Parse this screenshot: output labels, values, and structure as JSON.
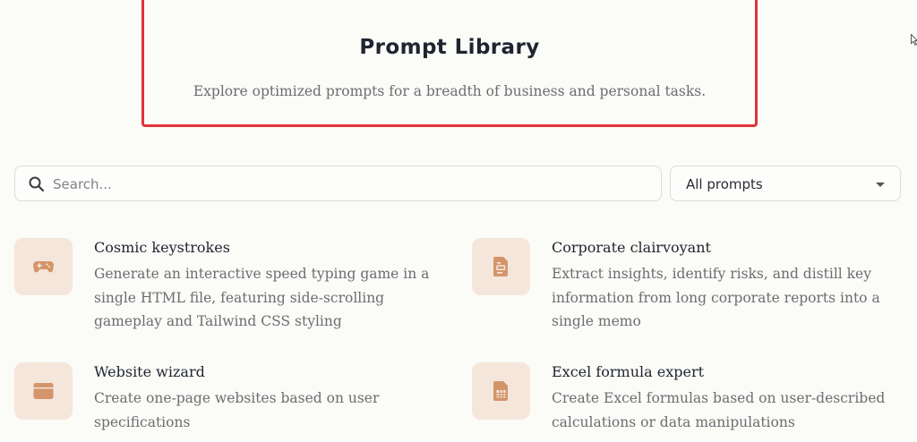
{
  "header": {
    "title": "Prompt Library",
    "subtitle": "Explore optimized prompts for a breadth of business and personal tasks."
  },
  "search": {
    "placeholder": "Search...",
    "value": ""
  },
  "filter": {
    "selected": "All prompts"
  },
  "cards": [
    {
      "icon": "gamepad-icon",
      "title": "Cosmic keystrokes",
      "description": "Generate an interactive speed typing game in a single HTML file, featuring side-scrolling gameplay and Tailwind CSS styling"
    },
    {
      "icon": "document-icon",
      "title": "Corporate clairvoyant",
      "description": "Extract insights, identify risks, and distill key information from long corporate reports into a single memo"
    },
    {
      "icon": "browser-window-icon",
      "title": "Website wizard",
      "description": "Create one-page websites based on user specifications"
    },
    {
      "icon": "spreadsheet-icon",
      "title": "Excel formula expert",
      "description": "Create Excel formulas based on user-described calculations or data manipulations"
    }
  ],
  "colors": {
    "accent_border": "#e0343a",
    "icon_tile": "#f5e6dc",
    "icon_glyph": "#d4956b",
    "background": "#fbfbf7"
  }
}
